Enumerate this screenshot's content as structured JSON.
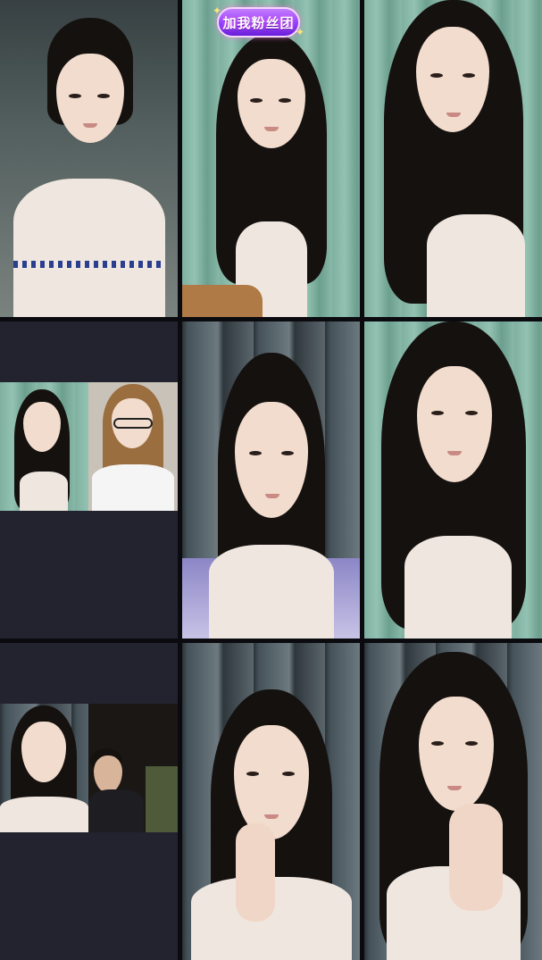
{
  "badge": {
    "label": "加我粉丝团"
  },
  "grid": {
    "rows": 3,
    "columns": 3,
    "tiles": [
      {
        "slot": "r1c1",
        "type": "camera"
      },
      {
        "slot": "r1c2",
        "type": "camera",
        "badge": true
      },
      {
        "slot": "r1c3",
        "type": "camera"
      },
      {
        "slot": "r2c1",
        "type": "pk-split"
      },
      {
        "slot": "r2c2",
        "type": "camera"
      },
      {
        "slot": "r2c3",
        "type": "camera"
      },
      {
        "slot": "r3c1",
        "type": "pk-split"
      },
      {
        "slot": "r3c2",
        "type": "camera"
      },
      {
        "slot": "r3c3",
        "type": "camera"
      }
    ]
  },
  "icons": {
    "badge_sparkle": "sparkle-icon"
  },
  "colors": {
    "panel": "#23232f",
    "divider": "#0b0b0f",
    "badge": "#8f3dff"
  }
}
